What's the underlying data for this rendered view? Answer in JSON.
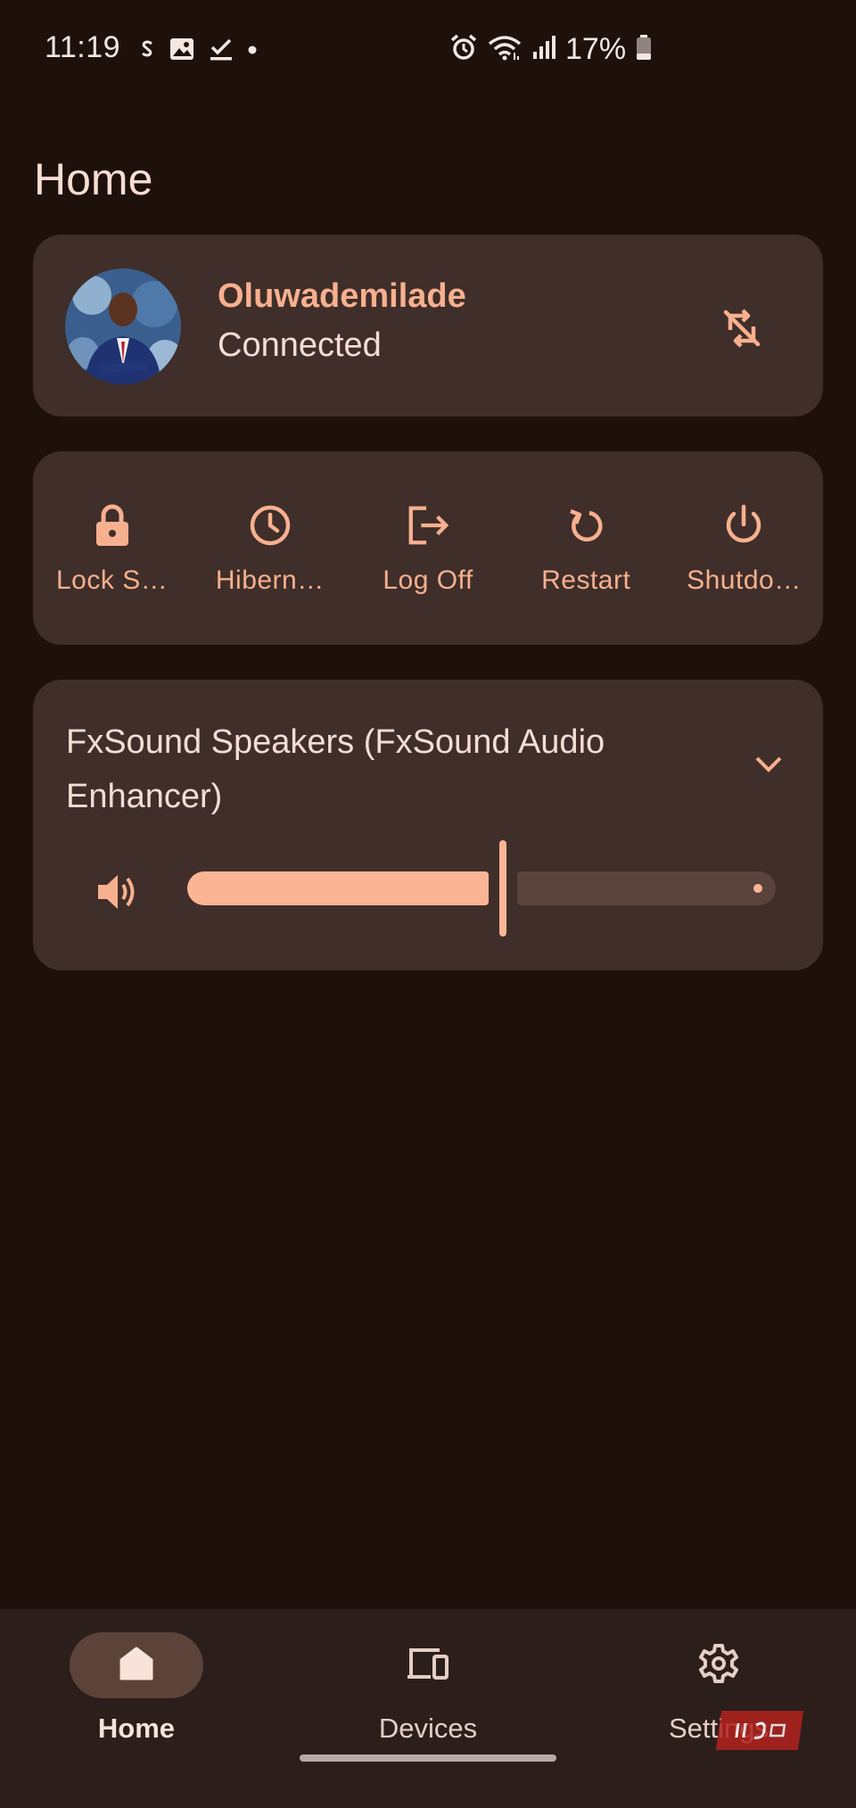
{
  "status_bar": {
    "time": "11:19",
    "battery": "17%"
  },
  "page_title": "Home",
  "connection": {
    "name": "Oluwademilade",
    "status": "Connected",
    "sync_icon": "sync-disabled-icon"
  },
  "power_actions": [
    {
      "label": "Lock S…",
      "icon": "lock-icon"
    },
    {
      "label": "Hibern…",
      "icon": "clock-icon"
    },
    {
      "label": "Log Off",
      "icon": "logout-icon"
    },
    {
      "label": "Restart",
      "icon": "restart-icon"
    },
    {
      "label": "Shutdo…",
      "icon": "power-icon"
    }
  ],
  "audio": {
    "device": "FxSound Speakers (FxSound Audio Enhancer)",
    "volume": 0.5,
    "volume_icon": "volume-up-icon"
  },
  "nav": {
    "items": [
      {
        "label": "Home",
        "icon": "home-icon",
        "active": true
      },
      {
        "label": "Devices",
        "icon": "devices-icon",
        "active": false
      },
      {
        "label": "Settings",
        "icon": "gear-icon",
        "active": false
      }
    ]
  },
  "colors": {
    "background": "#1e100b",
    "card": "#3f2e29",
    "accent": "#f7b08f",
    "nav_bar": "#2c1e1a"
  }
}
